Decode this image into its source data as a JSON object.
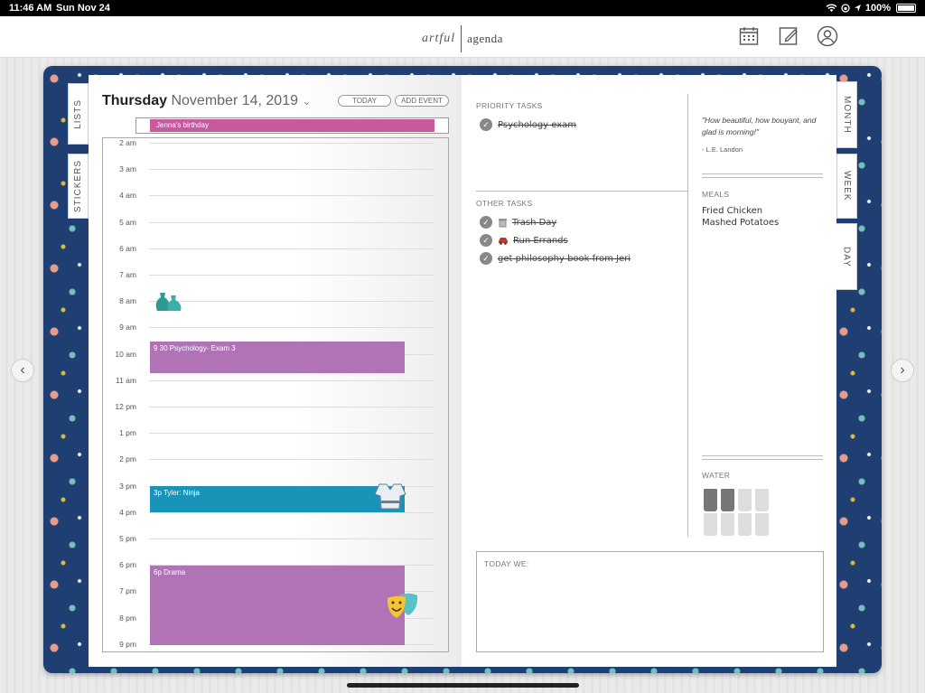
{
  "status": {
    "time": "11:46 AM",
    "date": "Sun Nov 24",
    "location": "◀",
    "battery": "100%"
  },
  "app": {
    "logo_a": "artful",
    "logo_b": "agenda"
  },
  "tabs_left": [
    "LISTS",
    "STICKERS"
  ],
  "tabs_right": [
    "MONTH",
    "WEEK",
    "DAY"
  ],
  "day": {
    "weekday": "Thursday",
    "date": "November 14, 2019",
    "today_label": "TODAY",
    "add_event_label": "ADD EVENT"
  },
  "all_day": [
    "Jenna's birthday"
  ],
  "hours": [
    "2 am",
    "3 am",
    "4 am",
    "5 am",
    "6 am",
    "7 am",
    "8 am",
    "9 am",
    "10 am",
    "11 am",
    "12 pm",
    "1 pm",
    "2 pm",
    "3 pm",
    "4 pm",
    "5 pm",
    "6 pm",
    "7 pm",
    "8 pm",
    "9 pm"
  ],
  "events": [
    {
      "title": "9 30 Psychology- Exam 3",
      "color": "#b074b6"
    },
    {
      "title": "3p Tyler: Ninja",
      "color": "#1a93b8"
    },
    {
      "title": "6p Drama",
      "color": "#b074b6"
    }
  ],
  "priority": {
    "label": "PRIORITY TASKS",
    "tasks": [
      "Psychology exam"
    ]
  },
  "other": {
    "label": "OTHER TASKS",
    "tasks": [
      "Trash Day",
      "Run Errands",
      "get philosophy book from Jeri"
    ]
  },
  "quote": {
    "text": "\"How beautiful, how bouyant, and glad is morning!\"",
    "author": "- L.E. Landon"
  },
  "meals": {
    "label": "MEALS",
    "items": [
      "Fried Chicken",
      "Mashed Potatoes"
    ]
  },
  "water": {
    "label": "WATER",
    "total": 8,
    "filled": 2
  },
  "today_we": {
    "label": "TODAY WE:"
  },
  "nav": {
    "prev": "‹",
    "next": "›"
  }
}
